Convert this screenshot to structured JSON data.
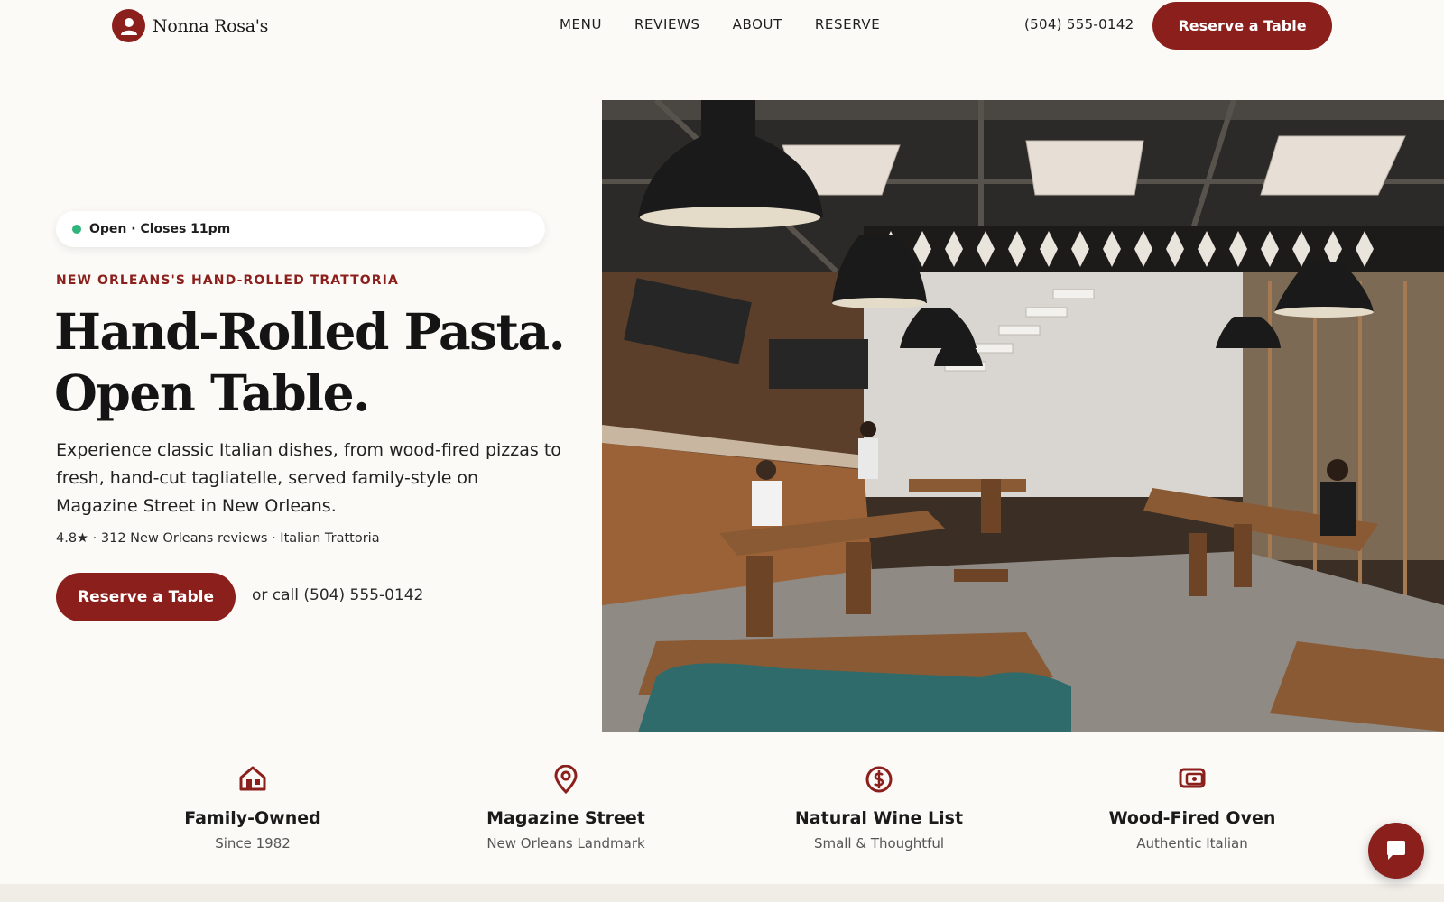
{
  "brand": {
    "name": "Nonna Rosa's",
    "icon": "person-icon",
    "color": "#8b1f1c"
  },
  "nav": {
    "links": [
      "MENU",
      "REVIEWS",
      "ABOUT",
      "RESERVE"
    ],
    "phone": "(504) 555-0142",
    "cta": "Reserve a Table"
  },
  "hero": {
    "status": "Open · Closes 11pm",
    "status_color": "#2fb57b",
    "eyebrow": "NEW ORLEANS'S HAND-ROLLED TRATTORIA",
    "headline_line1": "Hand-Rolled Pasta.",
    "headline_line2": "Open Table.",
    "lede": "Experience classic Italian dishes, from wood-fired pizzas to fresh, hand-cut tagliatelle, served family-style on Magazine Street in New Orleans.",
    "rating": "4.8★ · 312 New Orleans reviews · Italian Trattoria",
    "cta": "Reserve a Table",
    "call_text": "or call (504) 555-0142",
    "image_alt": "restaurant-interior-photo"
  },
  "features": [
    {
      "icon": "house-icon",
      "title": "Family-Owned",
      "subtitle": "Since 1982"
    },
    {
      "icon": "map-pin-icon",
      "title": "Magazine Street",
      "subtitle": "New Orleans Landmark"
    },
    {
      "icon": "dollar-circle-icon",
      "title": "Natural Wine List",
      "subtitle": "Small & Thoughtful"
    },
    {
      "icon": "oven-icon",
      "title": "Wood-Fired Oven",
      "subtitle": "Authentic Italian"
    }
  ],
  "chat": {
    "icon": "chat-bubble-icon"
  }
}
